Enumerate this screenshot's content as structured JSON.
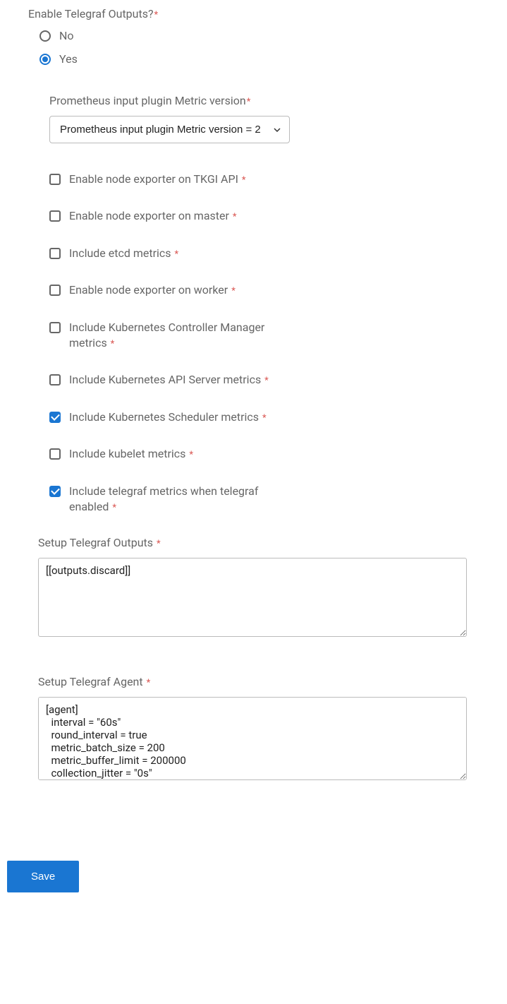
{
  "header": {
    "enable_label": "Enable Telegraf Outputs?"
  },
  "radio": {
    "no_label": "No",
    "yes_label": "Yes"
  },
  "metric_version": {
    "label": "Prometheus input plugin Metric version",
    "selected": "Prometheus input plugin Metric version = 2"
  },
  "checkboxes": {
    "node_exporter_api": "Enable node exporter on TKGI API",
    "node_exporter_master": "Enable node exporter on master",
    "etcd_metrics": "Include etcd metrics",
    "node_exporter_worker": "Enable node exporter on worker",
    "controller_manager": "Include Kubernetes Controller Manager metrics",
    "api_server": "Include Kubernetes API Server metrics",
    "scheduler": "Include Kubernetes Scheduler metrics",
    "kubelet": "Include kubelet metrics",
    "telegraf_metrics": "Include telegraf metrics when telegraf enabled"
  },
  "outputs_section": {
    "label": "Setup Telegraf Outputs",
    "value": "[[outputs.discard]]"
  },
  "agent_section": {
    "label": "Setup Telegraf Agent",
    "value": "[agent]\n  interval = \"60s\"\n  round_interval = true\n  metric_batch_size = 200\n  metric_buffer_limit = 200000\n  collection_jitter = \"0s\""
  },
  "buttons": {
    "save": "Save"
  }
}
